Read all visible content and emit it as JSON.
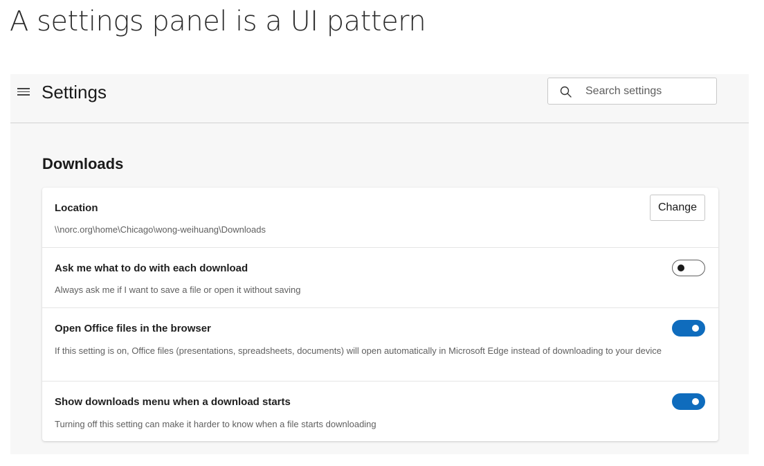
{
  "caption": "A settings panel is a UI pattern",
  "header": {
    "menu_icon": "hamburger-menu-icon",
    "title": "Settings",
    "search": {
      "icon": "search-icon",
      "placeholder": "Search settings"
    }
  },
  "section": {
    "title": "Downloads",
    "rows": [
      {
        "title": "Location",
        "desc": "\\\\norc.org\\home\\Chicago\\wong-weihuang\\Downloads",
        "control": "button",
        "button_label": "Change"
      },
      {
        "title": "Ask me what to do with each download",
        "desc": "Always ask me if I want to save a file or open it without saving",
        "control": "toggle",
        "on": false
      },
      {
        "title": "Open Office files in the browser",
        "desc": "If this setting is on, Office files (presentations, spreadsheets, documents) will open automatically in Microsoft Edge instead of downloading to your device",
        "control": "toggle",
        "on": true
      },
      {
        "title": "Show downloads menu when a download starts",
        "desc": "Turning off this setting can make it harder to know when a file starts downloading",
        "control": "toggle",
        "on": true
      }
    ]
  },
  "colors": {
    "toggle_on": "#0f6cbd",
    "panel_bg": "#f7f7f7"
  }
}
